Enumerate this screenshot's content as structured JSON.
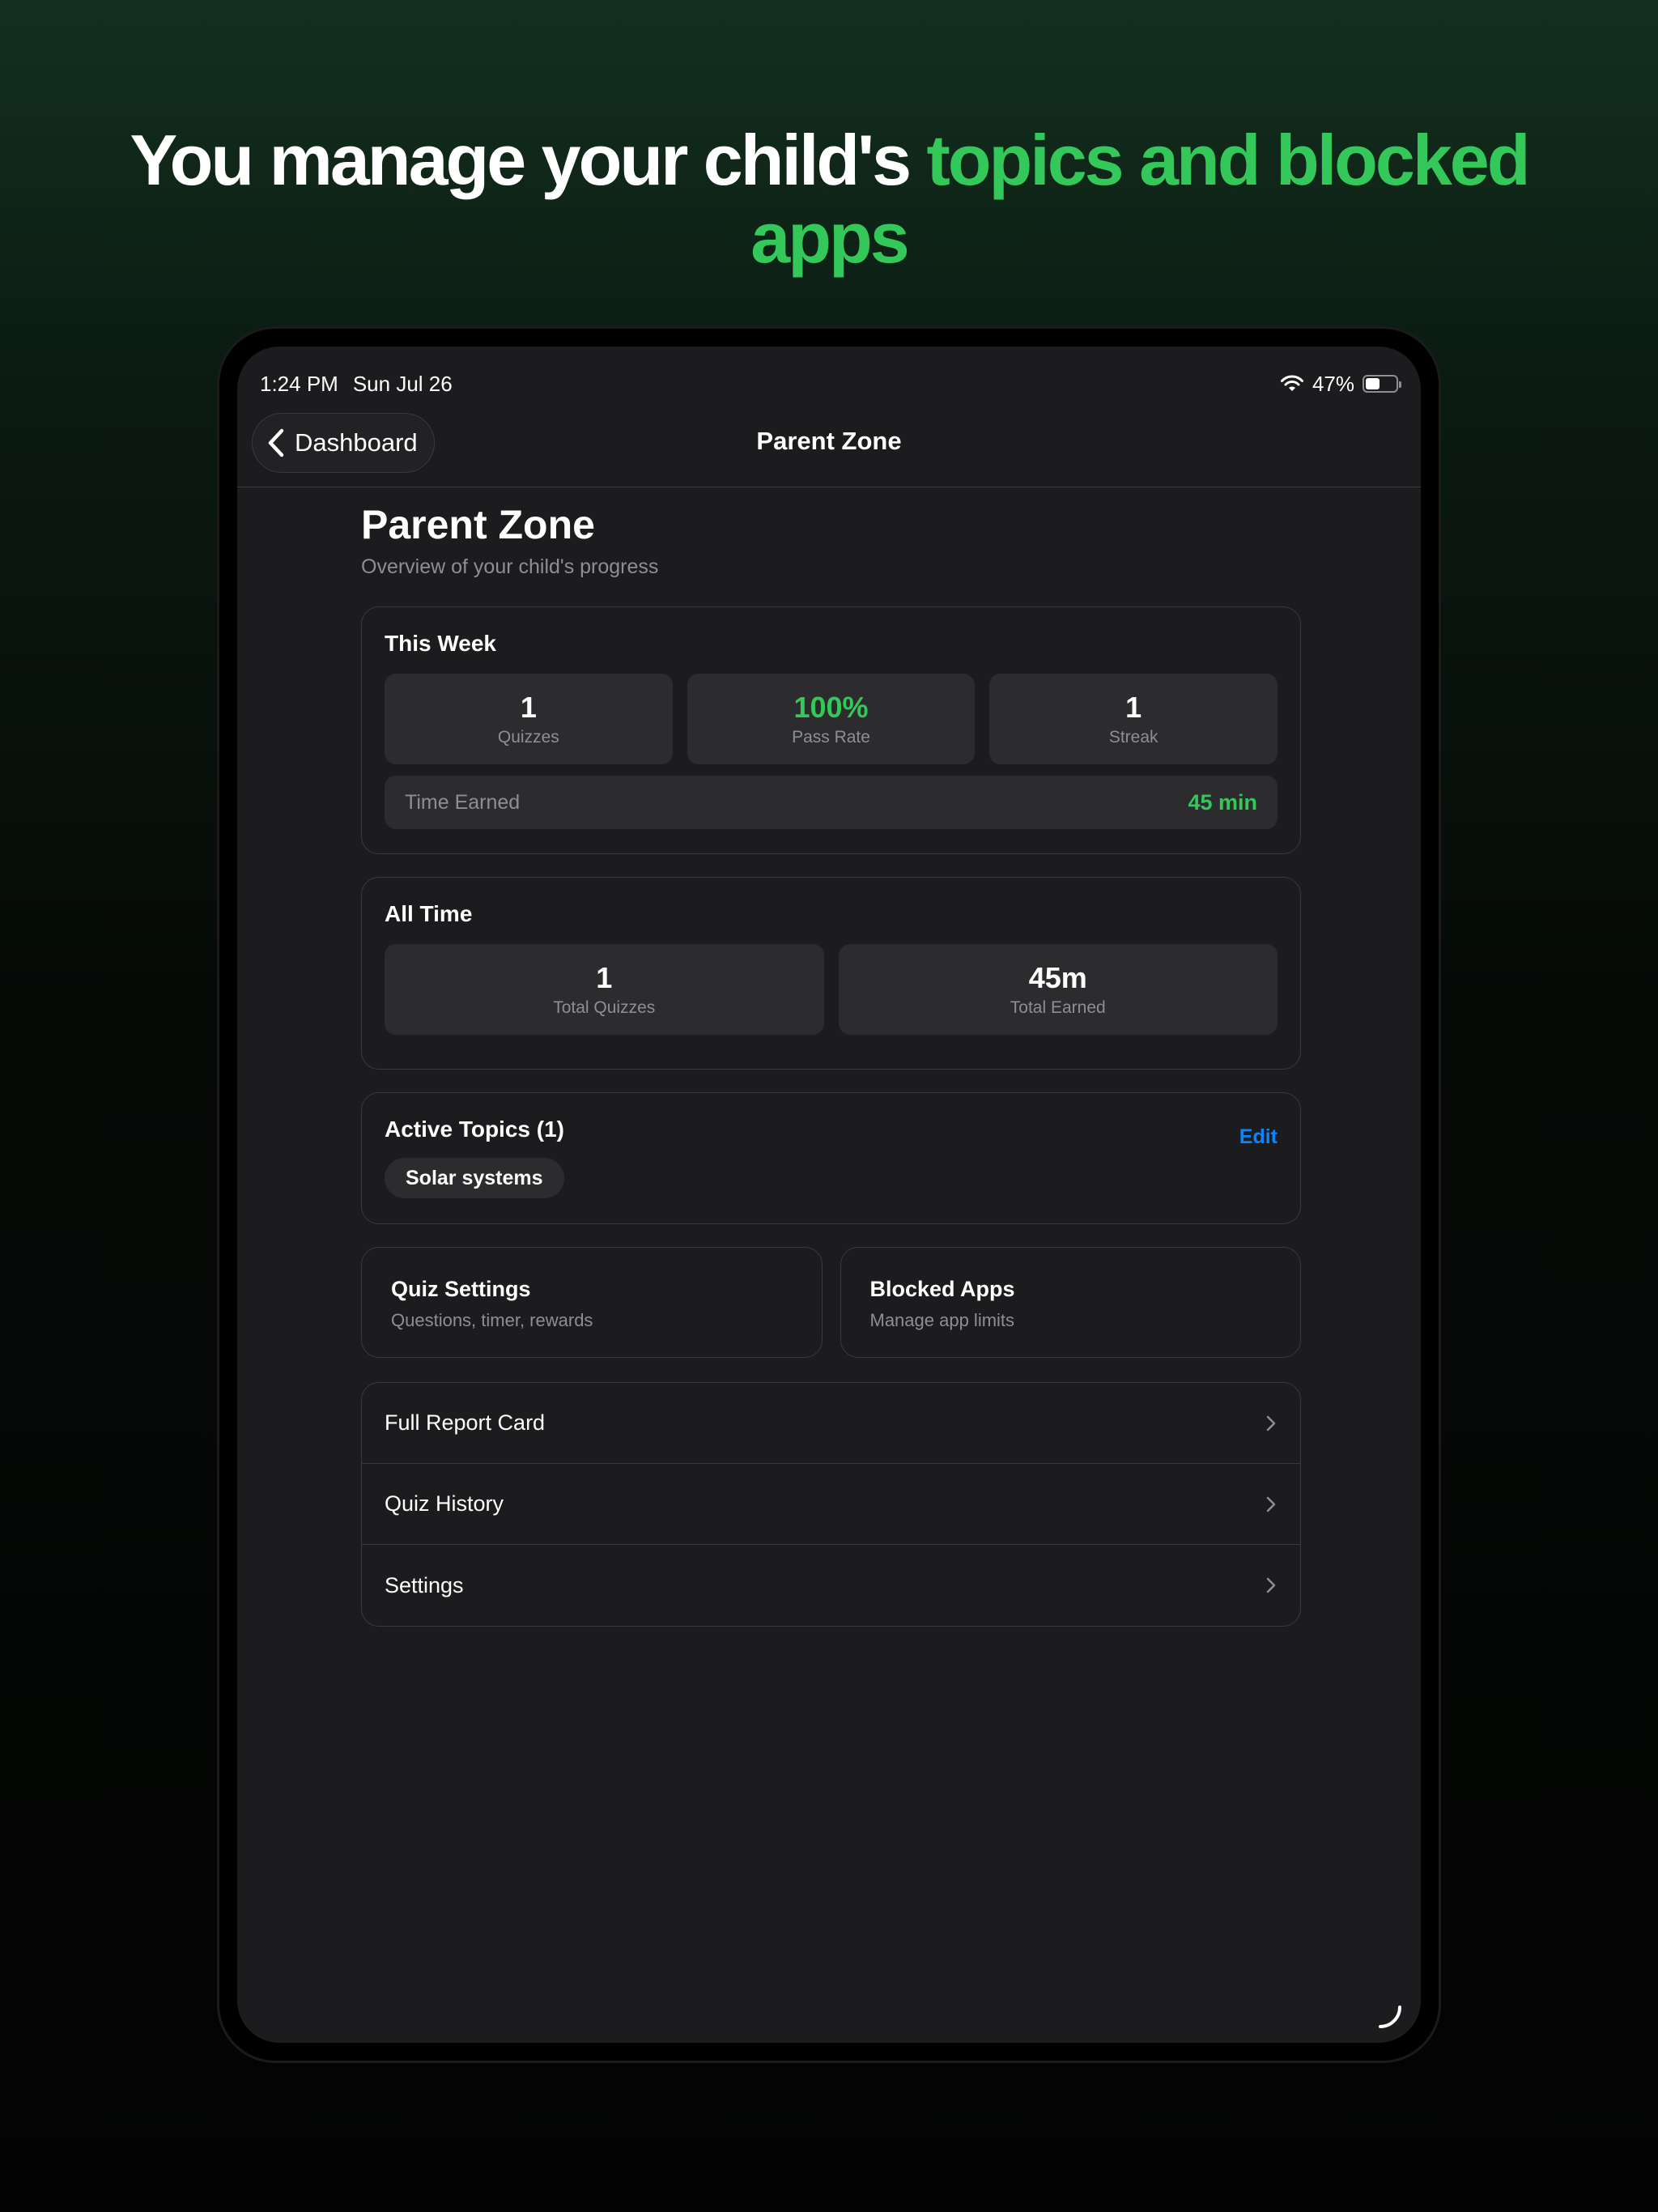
{
  "headline": {
    "prefix": "You manage your child's",
    "accent": "topics and blocked apps"
  },
  "status_bar": {
    "time": "1:24 PM",
    "date": "Sun Jul 26",
    "battery": "47%",
    "battery_level": 0.47
  },
  "navbar": {
    "back_label": "Dashboard",
    "title": "Parent Zone"
  },
  "page": {
    "title": "Parent Zone",
    "subtitle": "Overview of your child's progress"
  },
  "this_week": {
    "title": "This Week",
    "stats": [
      {
        "value": "1",
        "label": "Quizzes"
      },
      {
        "value": "100%",
        "label": "Pass Rate"
      },
      {
        "value": "1",
        "label": "Streak"
      }
    ],
    "time_earned_label": "Time Earned",
    "time_earned_value": "45 min"
  },
  "all_time": {
    "title": "All Time",
    "stats": [
      {
        "value": "1",
        "label": "Total Quizzes"
      },
      {
        "value": "45m",
        "label": "Total Earned"
      }
    ]
  },
  "active_topics": {
    "title": "Active Topics (1)",
    "edit_label": "Edit",
    "topics": [
      "Solar systems"
    ]
  },
  "tiles": [
    {
      "title": "Quiz Settings",
      "subtitle": "Questions, timer, rewards"
    },
    {
      "title": "Blocked Apps",
      "subtitle": "Manage app limits"
    }
  ],
  "menu": [
    {
      "label": "Full Report Card"
    },
    {
      "label": "Quiz History"
    },
    {
      "label": "Settings"
    }
  ],
  "colors": {
    "accent_green": "#34c759",
    "link_blue": "#0a84ff",
    "background": "#1c1c1e"
  },
  "icons": [
    "chevron-left-icon",
    "wifi-icon",
    "battery-icon",
    "chevron-right-icon"
  ]
}
